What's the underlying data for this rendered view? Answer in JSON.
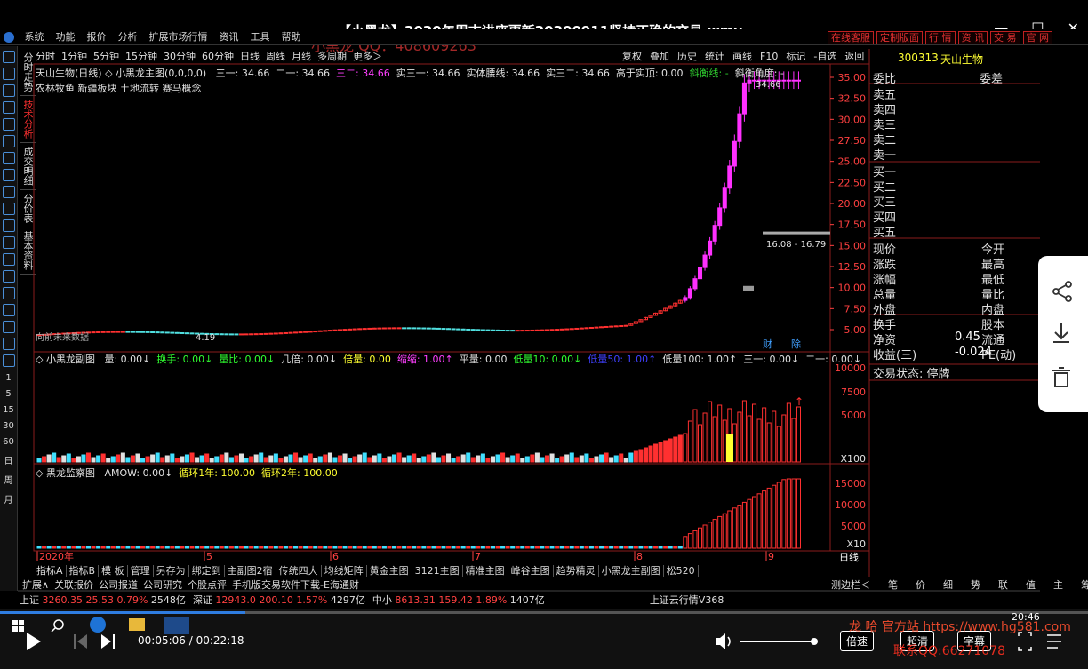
{
  "video": {
    "title": "【小黑龙】2020年周末讲座更新20200911坚持正确的交易.wmv",
    "watermark_top": "小黑龙 QQ：408609263",
    "time_current": "00:05:06",
    "time_total": "00:22:18",
    "time_sep": "/",
    "btn_speed": "倍速",
    "btn_hd": "超清",
    "btn_subtitle": "字幕",
    "watermark_bottom1": "龙 哈 官方站 https://www.hg581.com",
    "watermark_bottom2": "联系QQ:66271078",
    "clock": "20:46"
  },
  "menubar": {
    "items": [
      "系统",
      "功能",
      "报价",
      "分析",
      "扩展市场行情",
      "资讯",
      "工具",
      "帮助"
    ],
    "right_buttons": [
      "在线客服",
      "定制版面",
      "行 情",
      "资 讯",
      "交 易",
      "官 网"
    ]
  },
  "left_numbers": [
    "1",
    "5",
    "15",
    "30",
    "60",
    "日",
    "周",
    "月"
  ],
  "vertical_tabs": [
    {
      "label": "分时走势",
      "active": false
    },
    {
      "label": "技术分析",
      "active": true
    },
    {
      "label": "成交明细",
      "active": false
    },
    {
      "label": "分价表",
      "active": false
    },
    {
      "label": "基本资料",
      "active": false
    }
  ],
  "period_bar": [
    "分时",
    "1分钟",
    "5分钟",
    "15分钟",
    "30分钟",
    "60分钟",
    "日线",
    "周线",
    "月线",
    "多周期",
    "更多＞"
  ],
  "right_tool_bar": [
    "复权",
    "叠加",
    "历史",
    "统计",
    "画线",
    "F10",
    "标记",
    "-自选",
    "返回"
  ],
  "main_chart": {
    "title": "天山生物(日线)",
    "indicator_name": "小黑龙主图(0,0,0,0)",
    "values": [
      {
        "label": "三一: 34.66",
        "color": "#e0e0e0"
      },
      {
        "label": "二一: 34.66",
        "color": "#e0e0e0"
      },
      {
        "label": "三二: 34.66",
        "color": "#ff40ff"
      },
      {
        "label": "实三一: 34.66",
        "color": "#e0e0e0"
      },
      {
        "label": "实体腰线: 34.66",
        "color": "#e0e0e0"
      },
      {
        "label": "实三二: 34.66",
        "color": "#e0e0e0"
      },
      {
        "label": "高于实顶: 0.00",
        "color": "#e0e0e0"
      },
      {
        "label": "斜衡线: -",
        "color": "#30d030"
      },
      {
        "label": "斜衡角度: -",
        "color": "#e0e0e0"
      }
    ],
    "concepts": "农林牧鱼 新疆板块 土地流转 赛马概念",
    "no_data_label": "向前未来数据",
    "low_label": "4.19",
    "high_label": "34.66",
    "range_label": "16.08 - 16.79",
    "markers": [
      "财",
      "除"
    ],
    "y_ticks": [
      "35.00",
      "32.50",
      "30.00",
      "27.50",
      "25.00",
      "22.50",
      "20.00",
      "17.50",
      "15.00",
      "12.50",
      "10.00",
      "7.50",
      "5.00"
    ],
    "x_labels": [
      "2020年",
      "5",
      "6",
      "7",
      "8",
      "9"
    ]
  },
  "vol_chart": {
    "name": "小黑龙副图",
    "values": [
      {
        "label": "量: 0.00↓",
        "color": "#e0e0e0"
      },
      {
        "label": "换手: 0.00↓",
        "color": "#30ff30"
      },
      {
        "label": "量比: 0.00↓",
        "color": "#30ff30"
      },
      {
        "label": "几倍: 0.00↓",
        "color": "#e0e0e0"
      },
      {
        "label": "倍量: 0.00",
        "color": "#ffff30"
      },
      {
        "label": "缩缩: 1.00↑",
        "color": "#ff40ff"
      },
      {
        "label": "平量: 0.00",
        "color": "#e0e0e0"
      },
      {
        "label": "低量10: 0.00↓",
        "color": "#30ff30"
      },
      {
        "label": "低量50: 1.00↑",
        "color": "#4040ff"
      },
      {
        "label": "低量100: 1.00↑",
        "color": "#e0e0e0"
      },
      {
        "label": "三一: 0.00↓",
        "color": "#e0e0e0"
      },
      {
        "label": "二一: 0.00↓",
        "color": "#e0e0e0"
      }
    ],
    "y_ticks": [
      "10000",
      "7500",
      "5000",
      "X100"
    ]
  },
  "mon_chart": {
    "name": "黑龙监察图",
    "values": [
      {
        "label": "AMOW: 0.00↓",
        "color": "#e0e0e0"
      },
      {
        "label": "循环1年: 100.00",
        "color": "#ffff30"
      },
      {
        "label": "循环2年: 100.00",
        "color": "#ffff30"
      }
    ],
    "y_ticks": [
      "15000",
      "10000",
      "5000",
      "X10"
    ]
  },
  "tab_row1": [
    "指标A",
    "指标B",
    "模 板",
    "管理",
    "另存为",
    "绑定到",
    "主副图2宿",
    "传统四大",
    "均线矩阵",
    "黄金主图",
    "3121主图",
    "精准主图",
    "峰谷主图",
    "趋势精灵",
    "小黑龙主副图",
    "松520"
  ],
  "tab_row2": [
    "扩展∧",
    "关联报价",
    "公司报道",
    "公司研究",
    "个股点评",
    "手机版交易软件下载-E海通财"
  ],
  "period_right": "日线",
  "index_bar": [
    {
      "name": "上证",
      "value": "3260.35",
      "change": "25.53",
      "pct": "0.79%",
      "amount": "2548亿"
    },
    {
      "name": "深证",
      "value": "12943.0",
      "change": "200.10",
      "pct": "1.57%",
      "amount": "4297亿"
    },
    {
      "name": "中小",
      "value": "8613.31",
      "change": "159.42",
      "pct": "1.89%",
      "amount": "1407亿"
    }
  ],
  "cloud_label": "上证云行情V368",
  "right_panel": {
    "code": "300313",
    "name": "天山生物",
    "weibi_label": "委比",
    "weicha_label": "委差",
    "sell_labels": [
      "卖五",
      "卖四",
      "卖三",
      "卖二",
      "卖一"
    ],
    "buy_labels": [
      "买一",
      "买二",
      "买三",
      "买四",
      "买五"
    ],
    "stats": [
      {
        "l": "现价",
        "r": "今开",
        "v": ""
      },
      {
        "l": "涨跌",
        "r": "最高",
        "v": ""
      },
      {
        "l": "涨幅",
        "r": "最低",
        "v": ""
      },
      {
        "l": "总量",
        "r": "量比",
        "v": ""
      },
      {
        "l": "外盘",
        "r": "内盘",
        "v": ""
      },
      {
        "l": "换手",
        "r": "股本",
        "v": ""
      },
      {
        "l": "净资",
        "r": "流通",
        "v": "0.45"
      },
      {
        "l": "收益(三)",
        "r": "PE(动)",
        "v": "-0.024"
      }
    ],
    "status": "交易状态: 停牌"
  },
  "bottom_tabs": [
    "测边栏＜",
    "笔",
    "价",
    "细",
    "势",
    "联",
    "值",
    "主",
    "筹"
  ]
}
